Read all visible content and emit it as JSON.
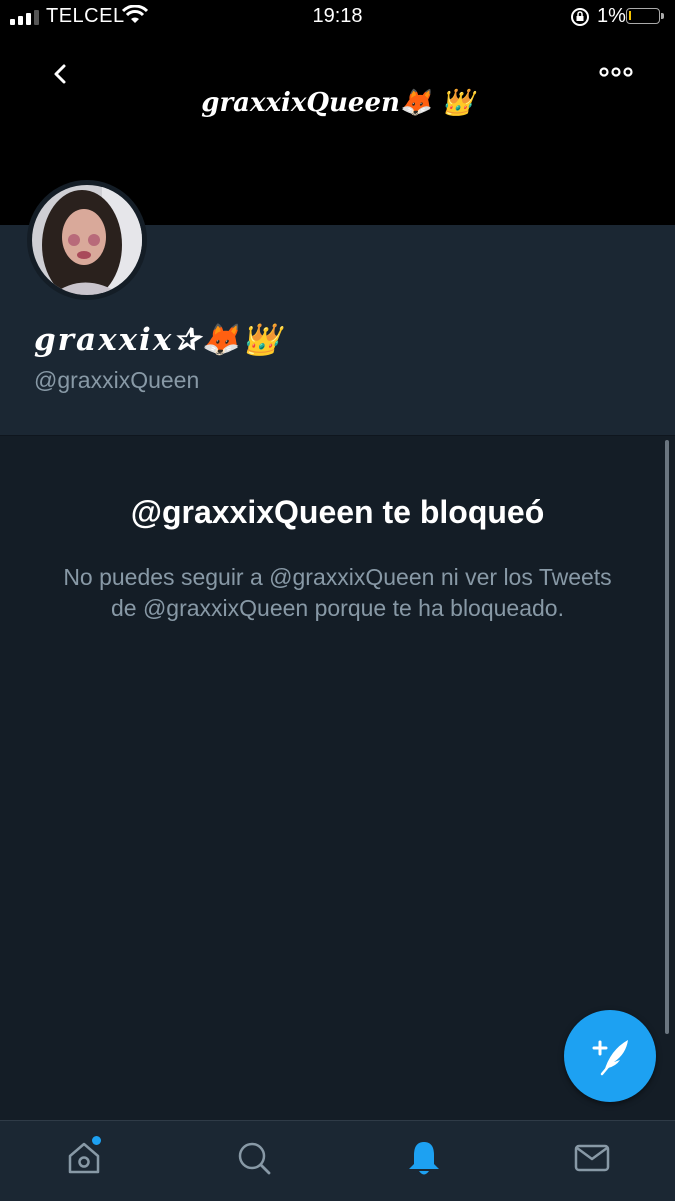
{
  "status_bar": {
    "carrier": "TELCEL",
    "time": "19:18",
    "battery_percent": "1%",
    "battery_level": 0.01
  },
  "header": {
    "title": "graxxixQueen🦊 👑"
  },
  "profile": {
    "display_name": "graxxix✰🦊👑",
    "handle": "@graxxixQueen"
  },
  "blocked": {
    "title": "@graxxixQueen te bloqueó",
    "message": "No puedes seguir a @graxxixQueen ni ver los Tweets de @graxxixQueen porque te ha bloqueado."
  },
  "colors": {
    "accent": "#1da1f2",
    "background": "#141d26",
    "card": "#1b2733",
    "secondary_text": "#8899a6"
  },
  "tabs": [
    {
      "icon": "home-icon",
      "badge": true
    },
    {
      "icon": "search-icon"
    },
    {
      "icon": "notifications-bell-icon",
      "active": true
    },
    {
      "icon": "messages-envelope-icon"
    }
  ]
}
